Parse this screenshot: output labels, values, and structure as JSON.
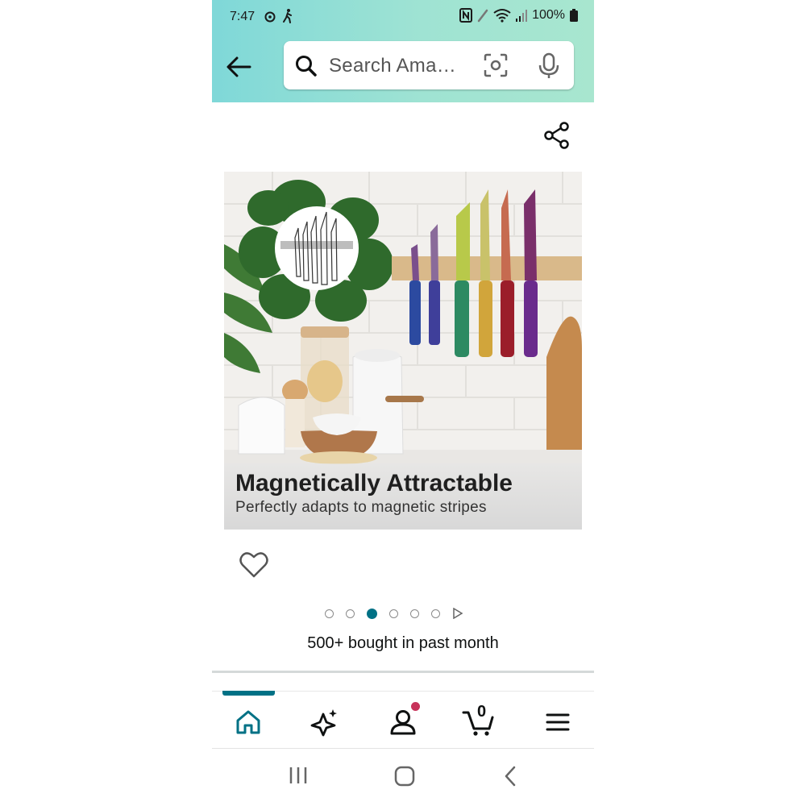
{
  "status_bar": {
    "time": "7:47",
    "battery": "100%",
    "left_icons": [
      "threads-icon",
      "walking-icon"
    ],
    "right_icons": [
      "nfc-icon",
      "pen-icon",
      "wifi-icon",
      "signal-icon",
      "battery-icon"
    ]
  },
  "header": {
    "search_placeholder": "Search Ama…"
  },
  "product_image": {
    "title": "Magnetically Attractable",
    "subtitle": "Perfectly adapts to magnetic stripes",
    "carousel_total": 6,
    "carousel_active_index": 2
  },
  "social_proof": "500+ bought in past month",
  "bottom_nav": {
    "items": [
      "home-icon",
      "sparkle-icon",
      "account-icon",
      "cart-icon",
      "menu-icon"
    ],
    "cart_count": "0"
  },
  "colors": {
    "accent": "#007185",
    "header_gradient_start": "#7fd8d8",
    "header_gradient_end": "#a8e6cf",
    "badge": "#c7335a"
  }
}
